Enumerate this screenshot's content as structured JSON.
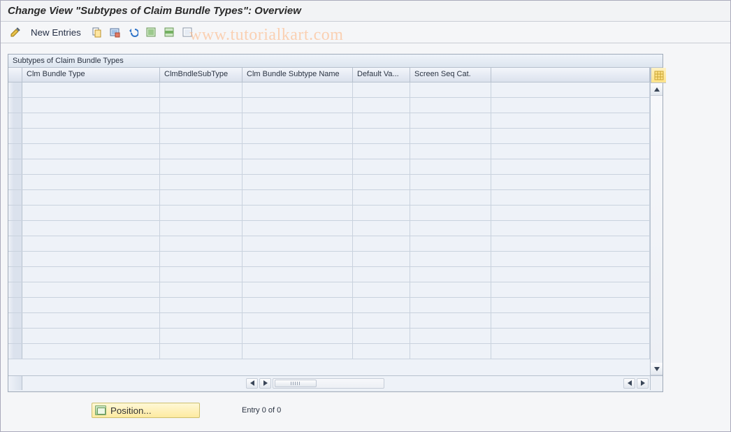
{
  "title": "Change View \"Subtypes of Claim Bundle Types\": Overview",
  "watermark": "www.tutorialkart.com",
  "toolbar": {
    "new_entries": "New Entries"
  },
  "panel": {
    "title": "Subtypes of Claim Bundle Types"
  },
  "columns": {
    "c1": "Clm Bundle Type",
    "c2": "ClmBndleSubType",
    "c3": "Clm Bundle Subtype Name",
    "c4": "Default Va...",
    "c5": "Screen Seq Cat."
  },
  "rows": [
    {},
    {},
    {},
    {},
    {},
    {},
    {},
    {},
    {},
    {},
    {},
    {},
    {},
    {},
    {},
    {},
    {},
    {}
  ],
  "footer": {
    "position_label": "Position...",
    "entry_text": "Entry 0 of 0"
  },
  "icons": {
    "toggle": "toggle-display-change-icon",
    "copy": "copy-icon",
    "delete": "delete-icon",
    "undo": "undo-icon",
    "select_all": "select-all-icon",
    "select_block": "select-block-icon",
    "deselect_all": "deselect-all-icon",
    "config": "table-settings-icon"
  }
}
